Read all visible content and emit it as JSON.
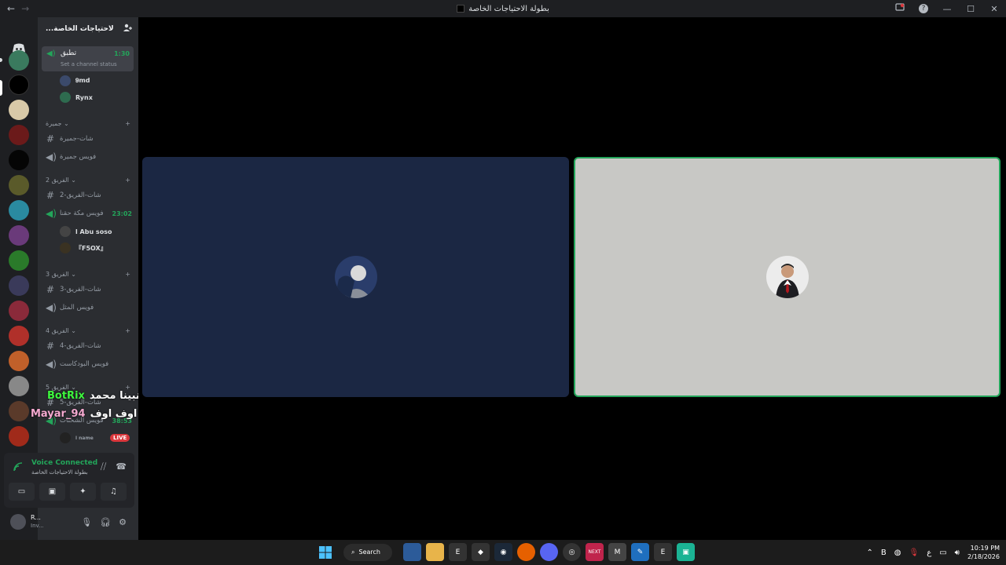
{
  "window": {
    "title": "بطولة الاحتياجات الخاصة",
    "nav_back": "←",
    "nav_forward": "→",
    "controls": {
      "help": "?",
      "minimize": "—",
      "maximize": "☐",
      "close": "✕"
    }
  },
  "server": {
    "name": "...لاحتياجات الخاصة"
  },
  "active_voice": {
    "name": "تطبق",
    "time": "1:30",
    "status": "Set a channel status"
  },
  "active_users": [
    {
      "name": "𝟗𝗺𝗱"
    },
    {
      "name": "Rynx"
    }
  ],
  "categories": [
    {
      "label": "جميرة ⌄"
    },
    {
      "label": "2 الفريق ⌄"
    },
    {
      "label": "3 الفريق ⌄"
    },
    {
      "label": "4 الفريق ⌄"
    },
    {
      "label": "5 الفريق ⌄"
    }
  ],
  "channels": [
    {
      "name": "شات-جميرة"
    },
    {
      "name": "فويس جميرة"
    },
    {
      "name": "شات-الفريق-2"
    },
    {
      "name": "فويس مكة حقنا",
      "time": "23:02"
    },
    {
      "name": "شات-الفريق-3"
    },
    {
      "name": "فويس المثل"
    },
    {
      "name": "شات-الفريق-4"
    },
    {
      "name": "فويس البودكاست"
    },
    {
      "name": "شات-الفريق-5"
    },
    {
      "name": "فويس الشحنات",
      "time": "38:53"
    }
  ],
  "channel_users": [
    {
      "name": "ا Abu soso"
    },
    {
      "name": "『F5OX』"
    },
    {
      "name": "ا name"
    }
  ],
  "live_badge": "LIVE",
  "voice_panel": {
    "title": "Voice Connected",
    "subtitle": "بطولة الاحتياجات الخاصة"
  },
  "user_panel": {
    "name": "R...",
    "status": "Inv..."
  },
  "stream_overlay": [
    {
      "user": "BotRix",
      "message": "صل على نبينا محمد"
    },
    {
      "user": "Mayar_94",
      "message": "اوف اوف"
    }
  ],
  "taskbar": {
    "search": "Search",
    "apps": [
      "Store",
      "Files",
      "Epic",
      "Unity",
      "Steam",
      "Firefox",
      "Discord",
      "Chrome",
      "NEXT",
      "Ghost",
      "Pen",
      "Epic",
      "App"
    ],
    "tray_lang": "ع",
    "time": "10:19 PM",
    "date": "2/18/2026"
  },
  "colors": {
    "accent_green": "#23a55a",
    "tile_dark": "#1b2743",
    "tile_light": "#c8c8c5",
    "live_red": "#da373c"
  }
}
